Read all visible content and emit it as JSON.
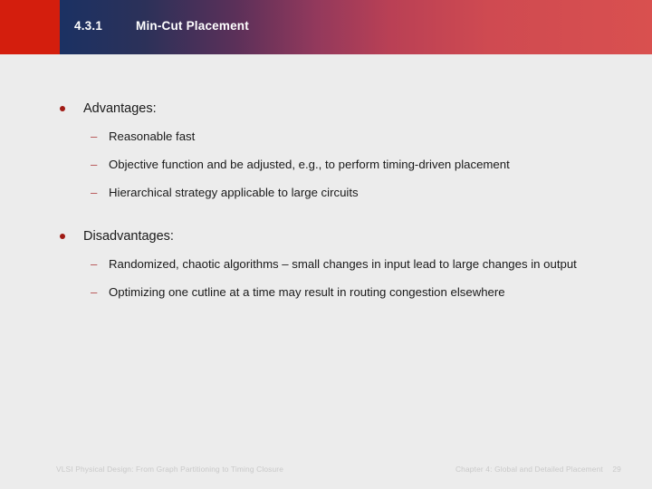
{
  "header": {
    "section_number": "4.3.1",
    "title": "Min-Cut Placement",
    "red_block_color": "#d41e0d",
    "gradient_start_color": "#1b3163",
    "gradient_end_color": "#d9504f",
    "text_color": "#ffffff"
  },
  "body": {
    "background_color": "#ececec",
    "text_color": "#1a1a1a",
    "bullet_color": "#a01a14",
    "dash_color": "#b3484a",
    "groups": [
      {
        "heading": "Advantages:",
        "bullet_glyph": "•",
        "items": [
          {
            "dash": "–",
            "text": "Reasonable fast"
          },
          {
            "dash": "–",
            "text": "Objective function and be adjusted, e.g., to perform timing-driven placement"
          },
          {
            "dash": "–",
            "text": "Hierarchical strategy applicable to large circuits"
          }
        ]
      },
      {
        "heading": "Disadvantages:",
        "bullet_glyph": "•",
        "items": [
          {
            "dash": "–",
            "text": "Randomized, chaotic algorithms – small changes in input lead to large changes in output"
          },
          {
            "dash": "–",
            "text": "Optimizing one cutline at a time may result in routing congestion elsewhere"
          }
        ]
      }
    ]
  },
  "footer": {
    "book_title": "VLSI Physical Design: From Graph Partitioning to Timing Closure",
    "chapter": "Chapter 4: Global and Detailed Placement",
    "page_number": "29",
    "text_color": "#c9c9c9"
  }
}
